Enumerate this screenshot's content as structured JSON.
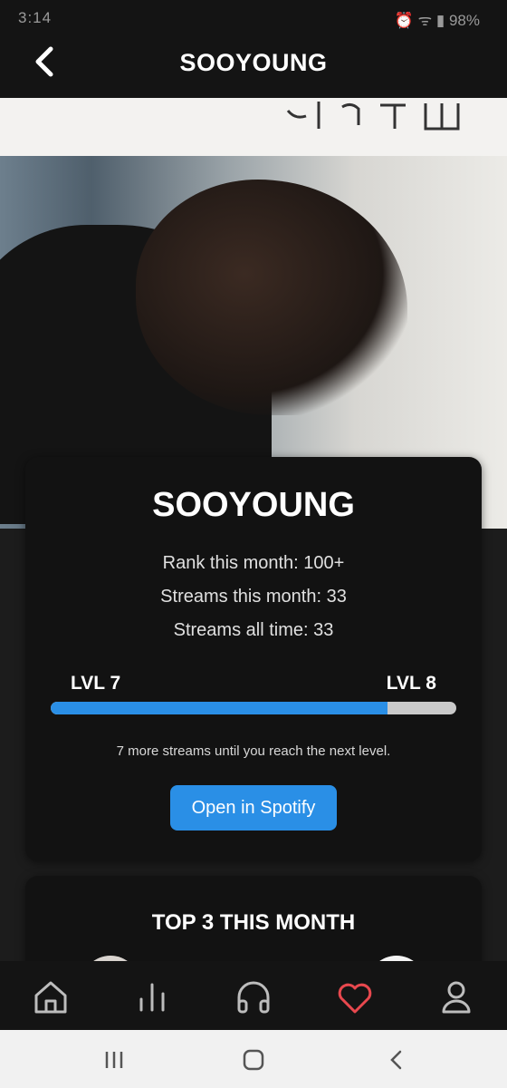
{
  "status_bar": {
    "time": "3:14",
    "battery": "98%"
  },
  "header": {
    "title": "SOOYOUNG"
  },
  "artist_card": {
    "name": "SOOYOUNG",
    "rank_line": "Rank this month: 100+",
    "streams_month_line": "Streams this month: 33",
    "streams_all_line": "Streams all time: 33",
    "level_current": "LVL 7",
    "level_next": "LVL 8",
    "level_progress_percent": 83,
    "hint": "7 more streams until you reach the next level.",
    "spotify_button": "Open in Spotify"
  },
  "top3_card": {
    "title": "TOP 3 THIS MONTH"
  },
  "bottom_nav": [
    "home-icon",
    "chart-icon",
    "headphones-icon",
    "heart-icon",
    "profile-icon"
  ],
  "colors": {
    "accent": "#2a8fe6",
    "heart": "#e8484e",
    "card": "#121212"
  }
}
